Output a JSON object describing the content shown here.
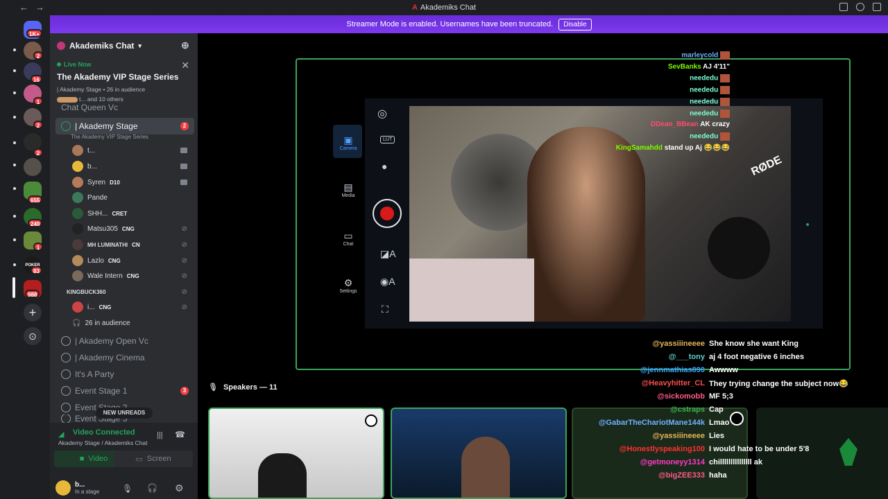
{
  "window": {
    "title": "Akademiks Chat"
  },
  "banner": {
    "text": "Streamer Mode is enabled. Usernames have been truncated.",
    "button": "Disable"
  },
  "guild_badges": [
    "1K+",
    "2",
    "16",
    "1",
    "2",
    "2",
    "655",
    "240",
    "1",
    "83",
    "988"
  ],
  "server": {
    "name": "Akademiks Chat"
  },
  "live": {
    "label": "Live Now",
    "title": "The Akademy VIP Stage Series",
    "meta": "| Akademy Stage • 26 in audience",
    "others": "t... and 10 others"
  },
  "channels": {
    "partial_top": "Chat Queen Vc",
    "stage": {
      "name": "| Akademy Stage",
      "badge": "2",
      "sub": "The Akademy VIP Stage Series"
    },
    "users": [
      {
        "name": "t...",
        "tag": ""
      },
      {
        "name": "b...",
        "tag": ""
      },
      {
        "name": "Syren",
        "tag": "D10"
      },
      {
        "name": "Pande",
        "tag": ""
      },
      {
        "name": "SHH...",
        "tag": "CRET"
      },
      {
        "name": "Matsu305",
        "tag": "CNG"
      },
      {
        "name": "MH LUMINATHI",
        "tag": "CN"
      },
      {
        "name": "Lazlo",
        "tag": "CNG"
      },
      {
        "name": "Wale Intern",
        "tag": "CNG"
      },
      {
        "name": "KINGBUCK360",
        "tag": ""
      },
      {
        "name": "i...",
        "tag": "CNG"
      }
    ],
    "audience": "26 in audience",
    "others": [
      {
        "name": "| Akademy Open Vc"
      },
      {
        "name": "| Akademy Cinema"
      },
      {
        "name": "It's A Party"
      },
      {
        "name": "Event Stage 1",
        "badge": "3"
      },
      {
        "name": "Event Stage 2"
      },
      {
        "name": "Event Stage 3"
      }
    ]
  },
  "new_unreads": "NEW UNREADS",
  "voice": {
    "status": "Video Connected",
    "location": "Akademy Stage / Akademiks Chat",
    "video_btn": "Video",
    "screen_btn": "Screen"
  },
  "userbar": {
    "name": "b...",
    "status": "In a stage"
  },
  "camera_ui": {
    "camera": "Camera",
    "media": "Media",
    "chat": "Chat",
    "settings": "Settings",
    "lut": "LUT",
    "brand": "RØDE"
  },
  "overlay_chat": [
    {
      "user": "marleycold",
      "msg": "",
      "color": "#6fb0ff"
    },
    {
      "user": "SevBanks",
      "msg": "AJ 4'11\"",
      "color": "#7cfc00"
    },
    {
      "user": "neededu",
      "msg": "",
      "color": "#7fffd4"
    },
    {
      "user": "neededu",
      "msg": "",
      "color": "#7fffd4"
    },
    {
      "user": "neededu",
      "msg": "",
      "color": "#7fffd4"
    },
    {
      "user": "neededu",
      "msg": "",
      "color": "#7fffd4"
    },
    {
      "user": "DDean_BBean",
      "msg": "AK crazy",
      "color": "#ff4d6a"
    },
    {
      "user": "neededu",
      "msg": "",
      "color": "#7fffd4"
    },
    {
      "user": "KingSamahdd",
      "msg": "stand up Aj 😂😂😂",
      "color": "#7cfc00"
    }
  ],
  "speakers": {
    "label": "Speakers — 11"
  },
  "chat": [
    {
      "user": "@yassiiineeee",
      "msg": "She know she want King",
      "color": "#e6b45a"
    },
    {
      "user": "@___tony",
      "msg": "aj 4 foot negative 6 inches",
      "color": "#5ad1c8"
    },
    {
      "user": "@jennmathias890",
      "msg": "Awwww",
      "color": "#3aa0ff"
    },
    {
      "user": "@Heavyhitter_CL",
      "msg": "They trying change the subject now😂",
      "color": "#ff4d4d"
    },
    {
      "user": "@sickomobb",
      "msg": "MF 5;3",
      "color": "#ff5a8a"
    },
    {
      "user": "@cstraps",
      "msg": "Cap",
      "color": "#3ab54a"
    },
    {
      "user": "@GabarTheChariotMane144k",
      "msg": "Lmao",
      "color": "#6fb0ff"
    },
    {
      "user": "@yassiiineeee",
      "msg": "Lies",
      "color": "#e6b45a"
    },
    {
      "user": "@Honestlyspeaking100",
      "msg": "I would hate to be under 5'8",
      "color": "#ff3030"
    },
    {
      "user": "@getmoneyy1314",
      "msg": "chilllllllllllllll ak",
      "color": "#ff3ac8"
    },
    {
      "user": "@bigZEE333",
      "msg": "haha",
      "color": "#ff5a8a"
    }
  ]
}
